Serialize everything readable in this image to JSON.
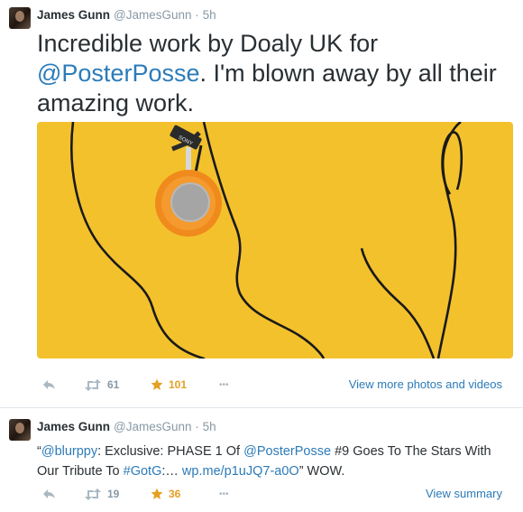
{
  "tweets": [
    {
      "author": "James Gunn",
      "handle": "@JamesGunn",
      "separator": "·",
      "time": "5h",
      "text_part1": "Incredible work by Doaly UK for",
      "mention": "@PosterPosse",
      "text_part2": ". I'm blown away by all their amazing work.",
      "retweets": "61",
      "favorites": "101",
      "more_icon": "•••",
      "expand_label": "View more photos and videos",
      "photo_brand": "SONY"
    },
    {
      "author": "James Gunn",
      "handle": "@JamesGunn",
      "separator": "·",
      "time": "5h",
      "q_open": "“",
      "mention1": "@blurppy",
      "text_a": ": Exclusive: PHASE 1 Of ",
      "mention2": "@PosterPosse",
      "text_b": " #9 Goes To The Stars With Our Tribute To ",
      "hashtag": "#GotG",
      "text_c": ":… ",
      "url": "wp.me/p1uJQ7-a0O",
      "text_d": "” WOW.",
      "retweets": "19",
      "favorites": "36",
      "more_icon": "•••",
      "expand_label": "View summary"
    }
  ],
  "colors": {
    "link": "#2b7bb9",
    "favorite": "#e4a023",
    "muted": "#8899a6",
    "photo_bg": "#f3c12c",
    "headphone_orange": "#f08a1c"
  }
}
